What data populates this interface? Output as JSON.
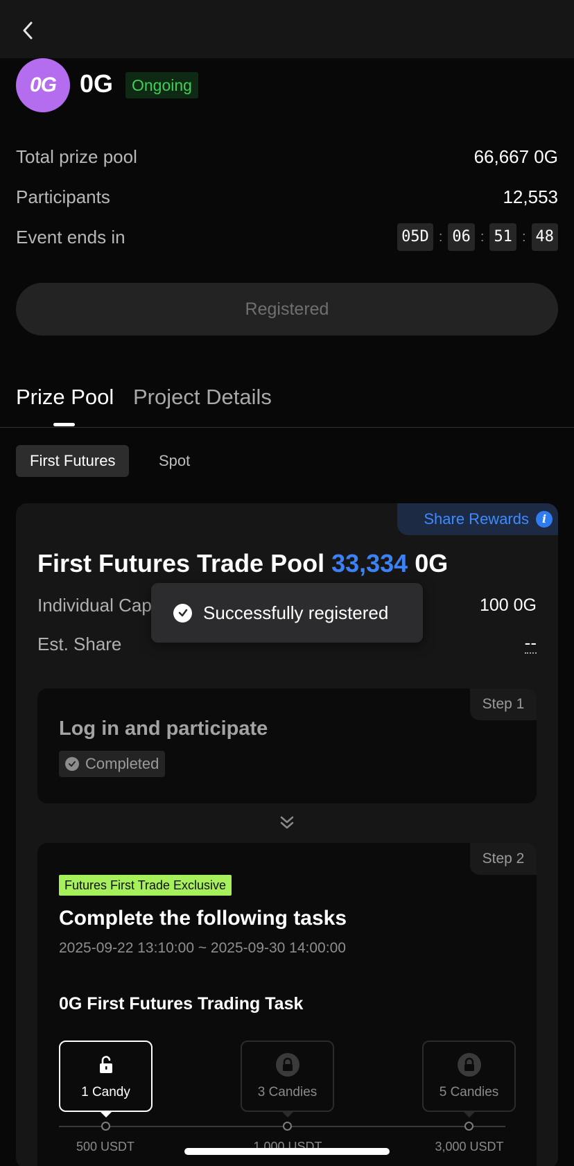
{
  "header": {
    "back_icon": "chevron-left-icon"
  },
  "project": {
    "logo_text": "0G",
    "logo_color": "#b56df0",
    "name": "0G",
    "status": "Ongoing",
    "status_color": "#3fce57"
  },
  "stats": {
    "prize_pool_label": "Total prize pool",
    "prize_pool_value": "66,667 0G",
    "participants_label": "Participants",
    "participants_value": "12,553",
    "ends_label": "Event ends in",
    "countdown": {
      "days": "05D",
      "hours": "06",
      "minutes": "51",
      "seconds": "48",
      "separator": ":"
    }
  },
  "register_button": "Registered",
  "tabs": {
    "prize_pool": "Prize Pool",
    "project_details": "Project Details"
  },
  "subtabs": {
    "futures": "First Futures",
    "spot": "Spot"
  },
  "pool_card": {
    "share_rewards": "Share Rewards",
    "title_prefix": "First Futures Trade Pool",
    "title_amount": "33,334",
    "title_suffix": "0G",
    "accent_color": "#3b82f6",
    "cap_label": "Individual Cap",
    "cap_value": "100 0G",
    "share_label": "Est. Share",
    "share_value": "--"
  },
  "step1": {
    "step_label": "Step 1",
    "title": "Log in and participate",
    "status": "Completed"
  },
  "step2": {
    "step_label": "Step 2",
    "tag": "Futures First Trade Exclusive",
    "tag_color": "#a5f05b",
    "title": "Complete the following tasks",
    "date_range": "2025-09-22 13:10:00 ~ 2025-09-30 14:00:00",
    "task_title": "0G First Futures Trading Task",
    "rewards": [
      {
        "label": "1 Candy",
        "tier": "500 USDT",
        "state": "unlocked"
      },
      {
        "label": "3 Candies",
        "tier": "1,000 USDT",
        "state": "locked"
      },
      {
        "label": "5 Candies",
        "tier": "3,000 USDT",
        "state": "locked"
      }
    ]
  },
  "toast": {
    "message": "Successfully registered"
  }
}
